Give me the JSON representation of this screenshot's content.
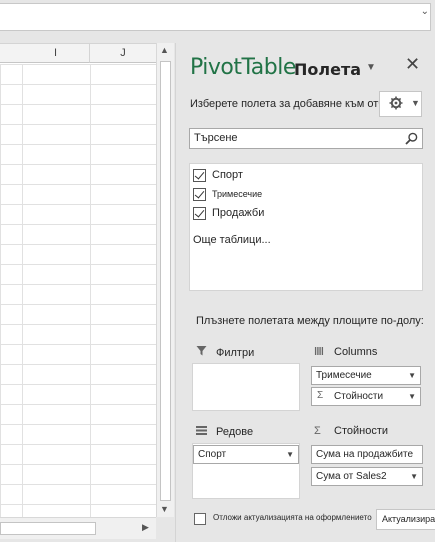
{
  "formula_bar": {
    "value": ""
  },
  "sheet": {
    "columns": [
      "I",
      "J"
    ]
  },
  "panel": {
    "title": "PivotTable",
    "subtitle": "Полета",
    "choose_fields_label": "Изберете полета за добавяне към отчета:",
    "search": {
      "value": "Търсене"
    },
    "fields": [
      {
        "label": "Спорт",
        "checked": true
      },
      {
        "label": "Тримесечие",
        "checked": true
      },
      {
        "label": "Продажби",
        "checked": true
      }
    ],
    "more_tables": "Още таблици...",
    "areas_hint": "Плъзнете полетата между площите по-долу:",
    "areas": {
      "filters": {
        "title": "Филтри",
        "items": []
      },
      "columns": {
        "title": "Columns",
        "items": [
          "Тримесечие",
          "Стойности"
        ]
      },
      "rows": {
        "title": "Редове",
        "items": [
          "Спорт"
        ]
      },
      "values": {
        "title": "Стойности",
        "items": [
          "Сума на продажбите",
          "Сума от Sales2"
        ]
      }
    },
    "defer_label": "Отложи актуализацията на оформлението",
    "update_button": "Актуализирай"
  },
  "colors": {
    "accent": "#217346",
    "panel_bg": "#e6e6e6"
  }
}
